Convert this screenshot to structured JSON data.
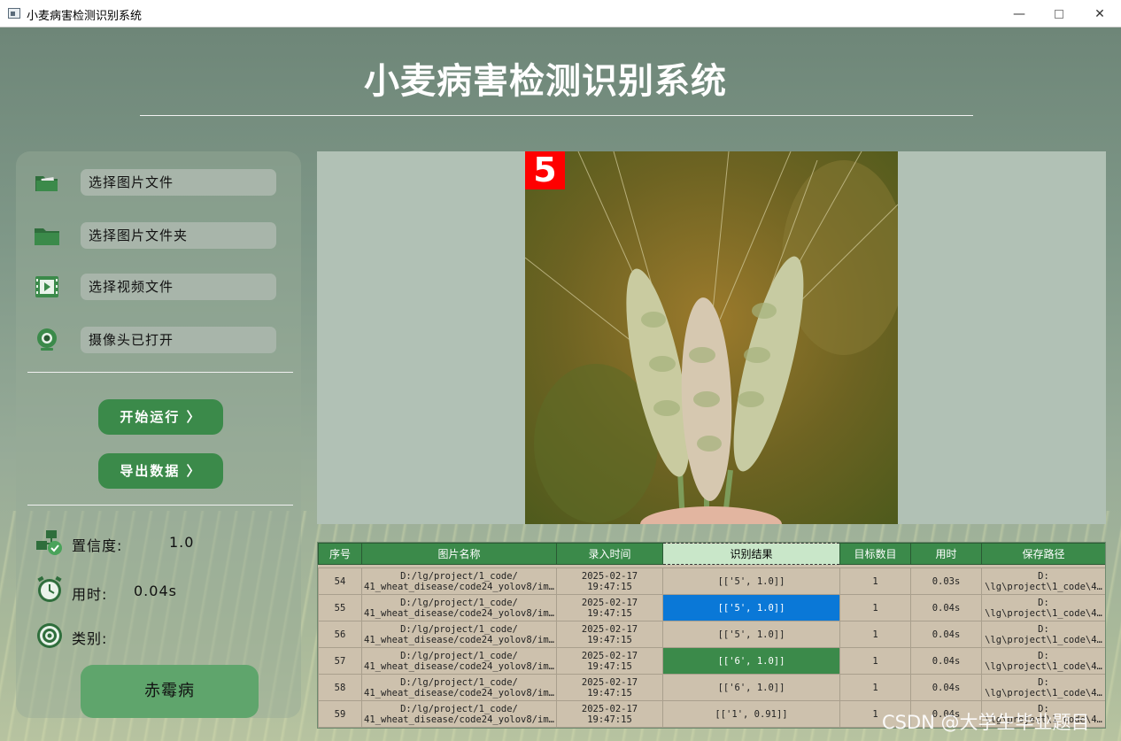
{
  "window": {
    "title": "小麦病害检测识别系统"
  },
  "header": {
    "title": "小麦病害检测识别系统"
  },
  "sidebar": {
    "buttons": [
      {
        "label": "选择图片文件",
        "icon": "image-folder-icon"
      },
      {
        "label": "选择图片文件夹",
        "icon": "folder-icon"
      },
      {
        "label": "选择视频文件",
        "icon": "video-file-icon"
      },
      {
        "label": "摄像头已打开",
        "icon": "camera-icon"
      }
    ],
    "actions": {
      "start": "开始运行 〉",
      "export": "导出数据 〉"
    },
    "info": {
      "confidence_label": "置信度:",
      "confidence_value": "1.0",
      "time_label": "用时:",
      "time_value": "0.04s",
      "class_label": "类别:",
      "class_value": "赤霉病"
    }
  },
  "detection": {
    "badge": "5"
  },
  "table": {
    "columns": [
      "序号",
      "图片名称",
      "录入时间",
      "识别结果",
      "目标数目",
      "用时",
      "保存路径"
    ],
    "rows": [
      {
        "id": "54",
        "name_1": "D:/lg/project/1_code/",
        "name_2": "41_wheat_disease/code24_yolov8/im…",
        "date": "2025-02-17",
        "time": "19:47:15",
        "result": "[['5', 1.0]]",
        "count": "1",
        "elapsed": "0.03s",
        "path_1": "D:",
        "path_2": "\\lg\\project\\1_code\\4…"
      },
      {
        "id": "55",
        "name_1": "D:/lg/project/1_code/",
        "name_2": "41_wheat_disease/code24_yolov8/im…",
        "date": "2025-02-17",
        "time": "19:47:15",
        "result": "[['5', 1.0]]",
        "count": "1",
        "elapsed": "0.04s",
        "path_1": "D:",
        "path_2": "\\lg\\project\\1_code\\4…"
      },
      {
        "id": "56",
        "name_1": "D:/lg/project/1_code/",
        "name_2": "41_wheat_disease/code24_yolov8/im…",
        "date": "2025-02-17",
        "time": "19:47:15",
        "result": "[['5', 1.0]]",
        "count": "1",
        "elapsed": "0.04s",
        "path_1": "D:",
        "path_2": "\\lg\\project\\1_code\\4…"
      },
      {
        "id": "57",
        "name_1": "D:/lg/project/1_code/",
        "name_2": "41_wheat_disease/code24_yolov8/im…",
        "date": "2025-02-17",
        "time": "19:47:15",
        "result": "[['6', 1.0]]",
        "count": "1",
        "elapsed": "0.04s",
        "path_1": "D:",
        "path_2": "\\lg\\project\\1_code\\4…"
      },
      {
        "id": "58",
        "name_1": "D:/lg/project/1_code/",
        "name_2": "41_wheat_disease/code24_yolov8/im…",
        "date": "2025-02-17",
        "time": "19:47:15",
        "result": "[['6', 1.0]]",
        "count": "1",
        "elapsed": "0.04s",
        "path_1": "D:",
        "path_2": "\\lg\\project\\1_code\\4…"
      },
      {
        "id": "59",
        "name_1": "D:/lg/project/1_code/",
        "name_2": "41_wheat_disease/code24_yolov8/im…",
        "date": "2025-02-17",
        "time": "19:47:15",
        "result": "[['1', 0.91]]",
        "count": "1",
        "elapsed": "0.04s",
        "path_1": "D:",
        "path_2": "\\lg\\project\\1_code\\4…"
      }
    ]
  },
  "watermark": "CSDN @大学生毕业题目",
  "colors": {
    "accent": "#3b8a4a",
    "selection": "#0a78d7",
    "badge": "#ff0000"
  }
}
